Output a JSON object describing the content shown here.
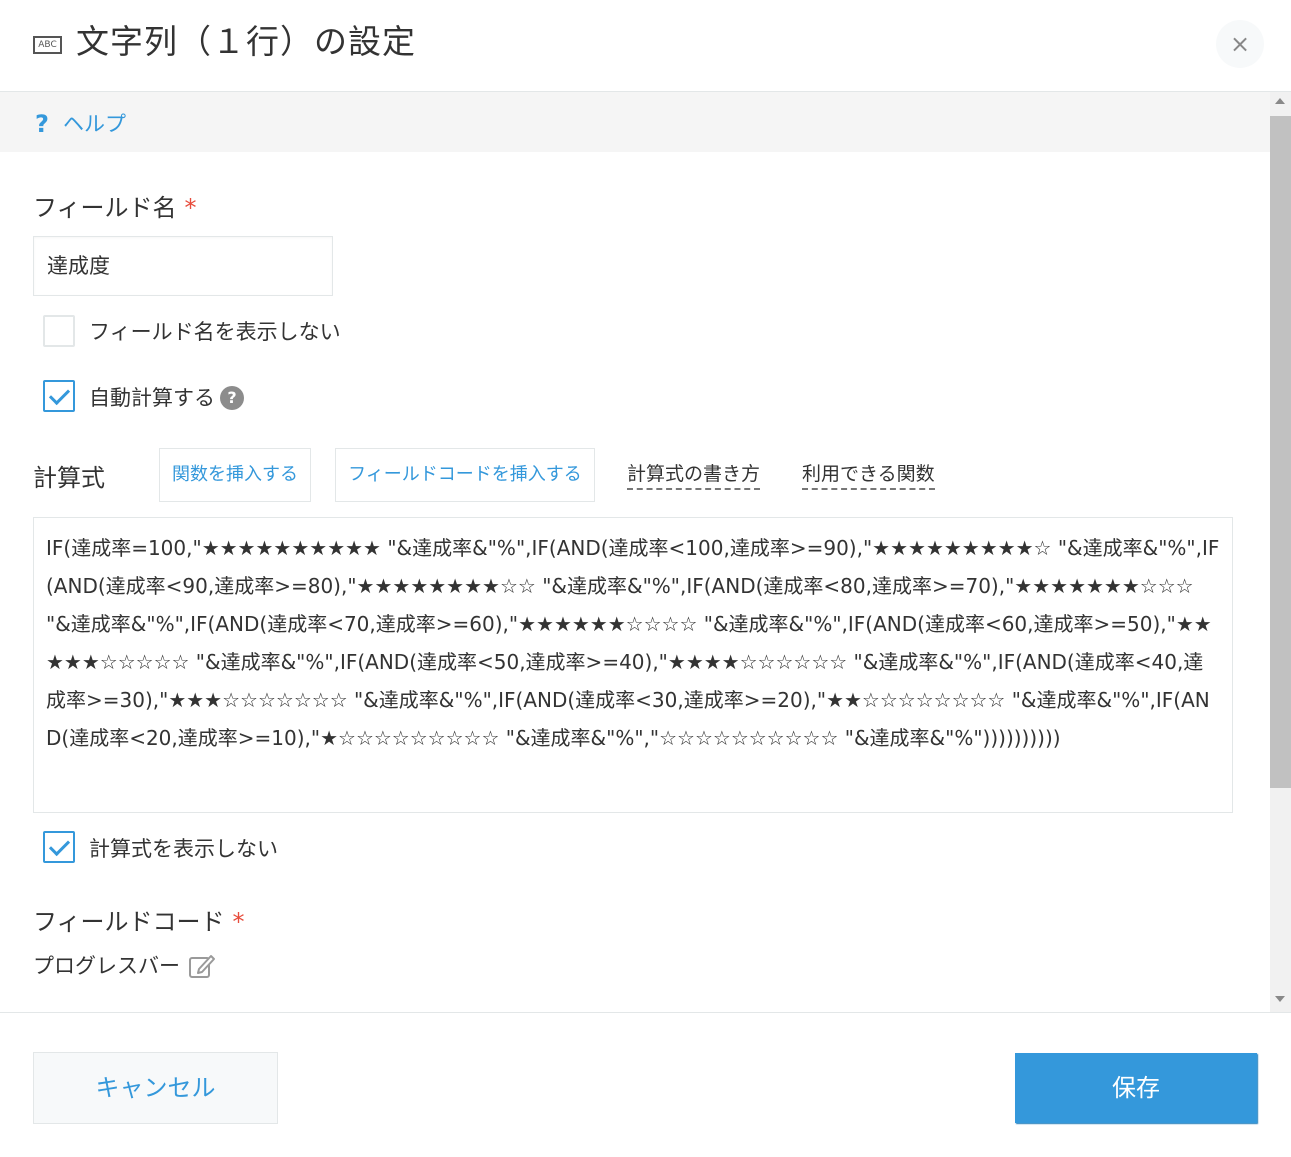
{
  "dialog": {
    "icon_text": "ABC",
    "title": "文字列（１行）の設定",
    "close_symbol": "×"
  },
  "help": {
    "icon": "?",
    "label": "ヘルプ"
  },
  "field_name": {
    "label": "フィールド名",
    "required_mark": "*",
    "value": "達成度"
  },
  "options": {
    "hide_field_name": {
      "label": "フィールド名を表示しない",
      "checked": false
    },
    "auto_calc": {
      "label": "自動計算する",
      "checked": true,
      "help_icon": "?"
    },
    "hide_formula": {
      "label": "計算式を表示しない",
      "checked": true
    }
  },
  "formula": {
    "label": "計算式",
    "insert_function": "関数を挿入する",
    "insert_field_code": "フィールドコードを挿入する",
    "how_to_write": "計算式の書き方",
    "available_functions": "利用できる関数",
    "value": "IF(達成率=100,\"★★★★★★★★★★ \"&達成率&\"%\",IF(AND(達成率<100,達成率>=90),\"★★★★★★★★★☆ \"&達成率&\"%\",IF(AND(達成率<90,達成率>=80),\"★★★★★★★★☆☆ \"&達成率&\"%\",IF(AND(達成率<80,達成率>=70),\"★★★★★★★☆☆☆ \"&達成率&\"%\",IF(AND(達成率<70,達成率>=60),\"★★★★★★☆☆☆☆ \"&達成率&\"%\",IF(AND(達成率<60,達成率>=50),\"★★★★★☆☆☆☆☆ \"&達成率&\"%\",IF(AND(達成率<50,達成率>=40),\"★★★★☆☆☆☆☆☆ \"&達成率&\"%\",IF(AND(達成率<40,達成率>=30),\"★★★☆☆☆☆☆☆☆ \"&達成率&\"%\",IF(AND(達成率<30,達成率>=20),\"★★☆☆☆☆☆☆☆☆ \"&達成率&\"%\",IF(AND(達成率<20,達成率>=10),\"★☆☆☆☆☆☆☆☆☆ \"&達成率&\"%\",\"☆☆☆☆☆☆☆☆☆☆ \"&達成率&\"%\"))))))))))"
  },
  "field_code": {
    "label": "フィールドコード",
    "required_mark": "*",
    "value": "プログレスバー",
    "edit_icon": "edit-icon"
  },
  "footer": {
    "cancel_label": "キャンセル",
    "save_label": "保存"
  },
  "colors": {
    "accent": "#3498db",
    "required": "#e74c3c",
    "help_bar_bg": "#f5f5f5"
  }
}
